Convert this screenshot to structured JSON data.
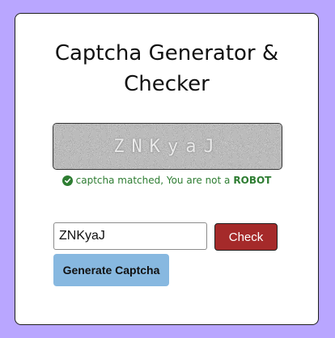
{
  "title": "Captcha Generator & Checker",
  "captcha": {
    "text": "ZNKyaJ"
  },
  "status": {
    "message": "captcha matched, You are not a",
    "highlight": "ROBOT",
    "icon": "check-circle-icon",
    "color": "#2e7d32"
  },
  "input": {
    "value": "ZNKyaJ"
  },
  "buttons": {
    "check_label": "Check",
    "generate_label": "Generate Captcha"
  },
  "colors": {
    "background": "#b9a6ff",
    "check_button": "#a52a2a",
    "generate_button": "#87b8e0"
  }
}
